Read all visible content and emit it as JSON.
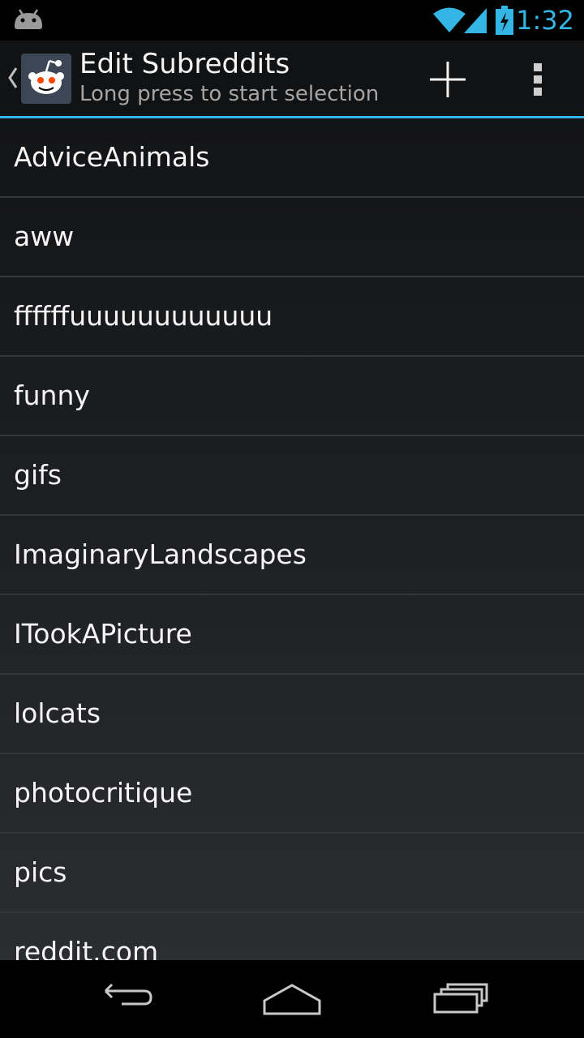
{
  "status_bar": {
    "time": "1:32",
    "icons": [
      "android-icon",
      "wifi-icon",
      "signal-icon",
      "battery-charging-icon"
    ],
    "accent_color": "#33b5e5"
  },
  "action_bar": {
    "title": "Edit Subreddits",
    "subtitle": "Long press to start selection",
    "icons": [
      "up-caret-icon",
      "reddit-app-icon",
      "add-icon",
      "overflow-menu-icon"
    ],
    "divider_color": "#33b5e5"
  },
  "subreddits": [
    "AdviceAnimals",
    "aww",
    "ffffffuuuuuuuuuuuu",
    "funny",
    "gifs",
    "ImaginaryLandscapes",
    "ITookAPicture",
    "lolcats",
    "photocritique",
    "pics",
    "reddit.com"
  ],
  "nav_bar": {
    "icons": [
      "back-icon",
      "home-icon",
      "recent-apps-icon"
    ]
  }
}
